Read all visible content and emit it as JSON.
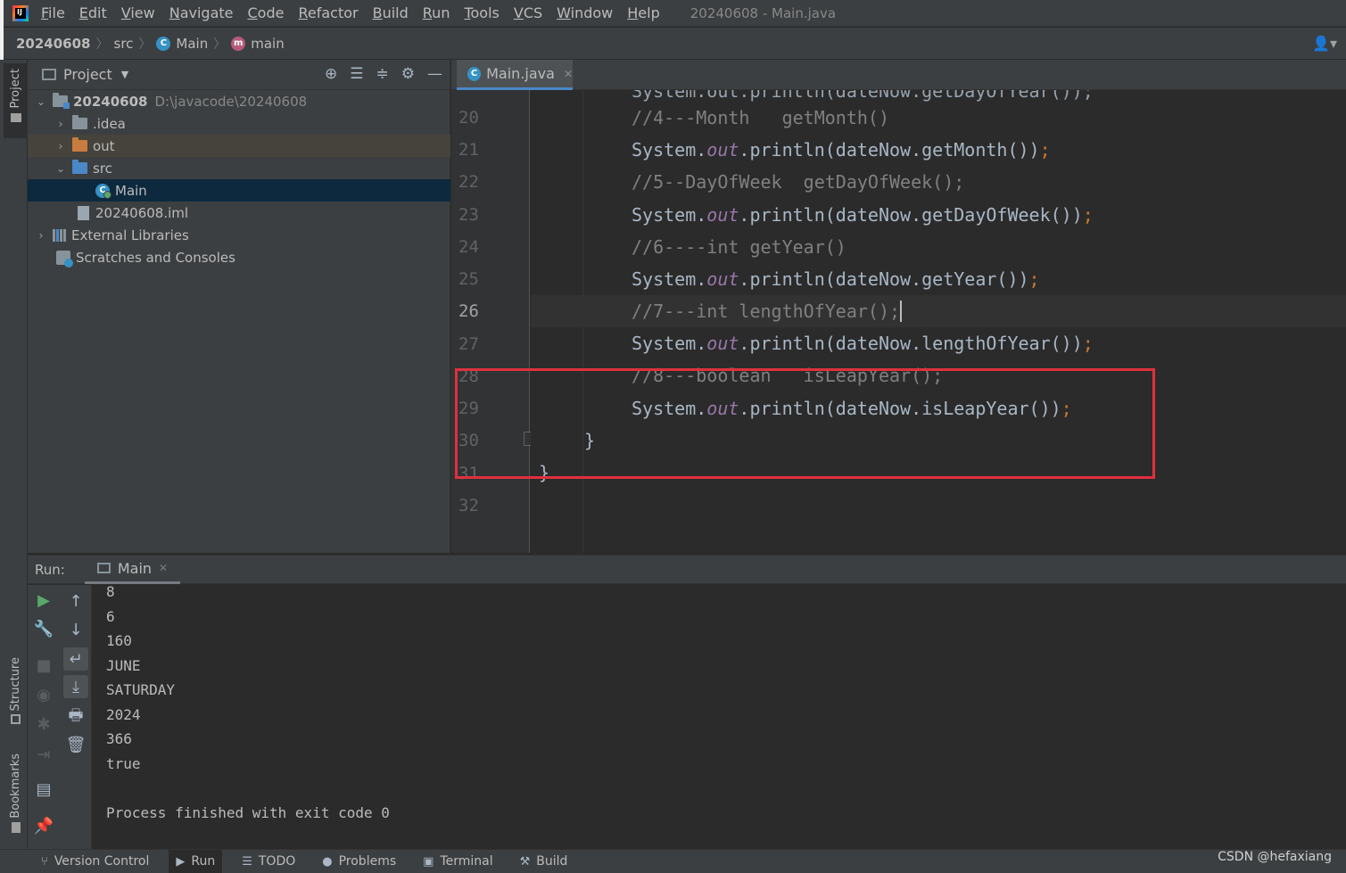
{
  "menubar": {
    "items": [
      "File",
      "Edit",
      "View",
      "Navigate",
      "Code",
      "Refactor",
      "Build",
      "Run",
      "Tools",
      "VCS",
      "Window",
      "Help"
    ],
    "window_title": "20240608 - Main.java"
  },
  "breadcrumb": {
    "project": "20240608",
    "folder": "src",
    "class_name": "Main",
    "method": "main"
  },
  "left_strip": {
    "project_tab": "Project",
    "structure_tab": "Structure",
    "bookmarks_tab": "Bookmarks"
  },
  "project_panel": {
    "title": "Project",
    "tree": {
      "root_name": "20240608",
      "root_path": "D:\\javacode\\20240608",
      "idea": ".idea",
      "out": "out",
      "src": "src",
      "main": "Main",
      "iml": "20240608.iml",
      "external_libraries": "External Libraries",
      "scratches": "Scratches and Consoles"
    }
  },
  "editor": {
    "tab_label": "Main.java",
    "line_numbers": [
      "20",
      "21",
      "22",
      "23",
      "24",
      "25",
      "26",
      "27",
      "28",
      "29",
      "30",
      "31",
      "32"
    ],
    "current_line": "26",
    "lines": {
      "l20": "//4---Month   getMonth()",
      "l21a": "System.",
      "l21b": "out",
      "l21c": ".println(dateNow.getMonth())",
      "l22": "//5--DayOfWeek  getDayOfWeek();",
      "l23a": "System.",
      "l23b": "out",
      "l23c": ".println(dateNow.getDayOfWeek())",
      "l24": "//6----int getYear()",
      "l25a": "System.",
      "l25b": "out",
      "l25c": ".println(dateNow.getYear())",
      "l26": "//7---int lengthOfYear();",
      "l27a": "System.",
      "l27b": "out",
      "l27c": ".println(dateNow.lengthOfYear())",
      "l28": "//8---boolean   isLeapYear();",
      "l29a": "System.",
      "l29b": "out",
      "l29c": ".println(dateNow.isLeapYear())",
      "semicolon": ";",
      "l30": "}",
      "l31": "}"
    }
  },
  "run_panel": {
    "label": "Run:",
    "tab_label": "Main",
    "output": [
      "8",
      "6",
      "160",
      "JUNE",
      "SATURDAY",
      "2024",
      "366",
      "true"
    ],
    "exit_message": "Process finished with exit code 0"
  },
  "statusbar": {
    "version_control": "Version Control",
    "run": "Run",
    "todo": "TODO",
    "problems": "Problems",
    "terminal": "Terminal",
    "build": "Build"
  },
  "watermark": "CSDN @hefaxiang",
  "colors": {
    "highlight_box": "#e0303e",
    "keyword": "#cc7832",
    "field": "#9876aa",
    "comment": "#808080",
    "selection": "#0d293e"
  }
}
